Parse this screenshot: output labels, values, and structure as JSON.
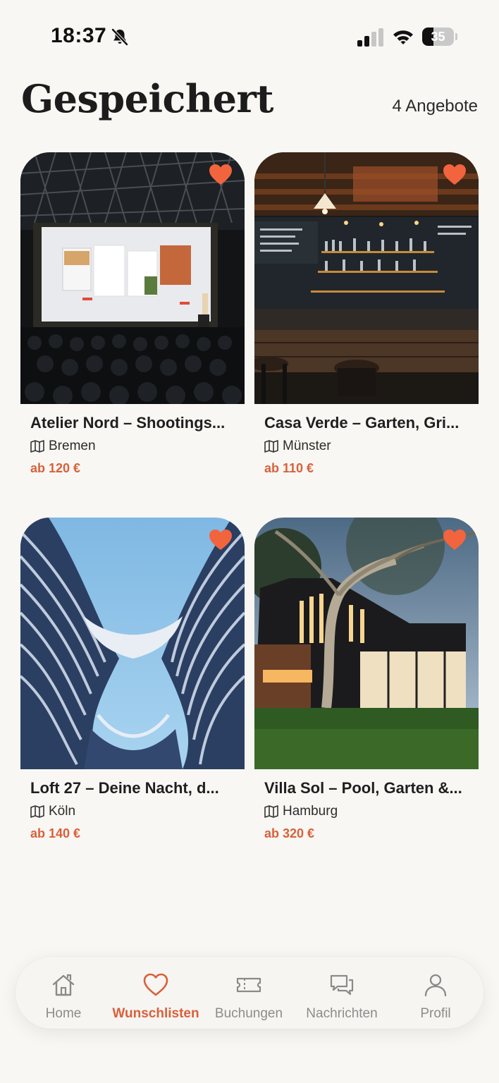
{
  "status_bar": {
    "time": "18:37",
    "battery_level": "35",
    "battery_fraction": 0.35
  },
  "header": {
    "title": "Gespeichert",
    "count_label": "4 Angebote"
  },
  "listings": [
    {
      "title": "Atelier Nord – Shootings...",
      "location": "Bremen",
      "price": "ab 120 €",
      "image": "conference-stage-photo",
      "favorited": true
    },
    {
      "title": "Casa Verde – Garten, Gri...",
      "location": "Münster",
      "price": "ab 110 €",
      "image": "bar-interior-photo",
      "favorited": true
    },
    {
      "title": "Loft 27 – Deine Nacht, d...",
      "location": "Köln",
      "price": "ab 140 €",
      "image": "curved-architecture-photo",
      "favorited": true
    },
    {
      "title": "Villa Sol – Pool, Garten &...",
      "location": "Hamburg",
      "price": "ab 320 €",
      "image": "modern-villa-photo",
      "favorited": true
    }
  ],
  "tab_bar": {
    "items": [
      {
        "label": "Home",
        "icon": "home-icon"
      },
      {
        "label": "Wunschlisten",
        "icon": "heart-icon",
        "active": true
      },
      {
        "label": "Buchungen",
        "icon": "ticket-icon"
      },
      {
        "label": "Nachrichten",
        "icon": "chat-bubbles-icon"
      },
      {
        "label": "Profil",
        "icon": "person-icon"
      }
    ]
  },
  "colors": {
    "accent": "#d9603a",
    "heart": "#f2643e",
    "background": "#f8f7f4"
  }
}
